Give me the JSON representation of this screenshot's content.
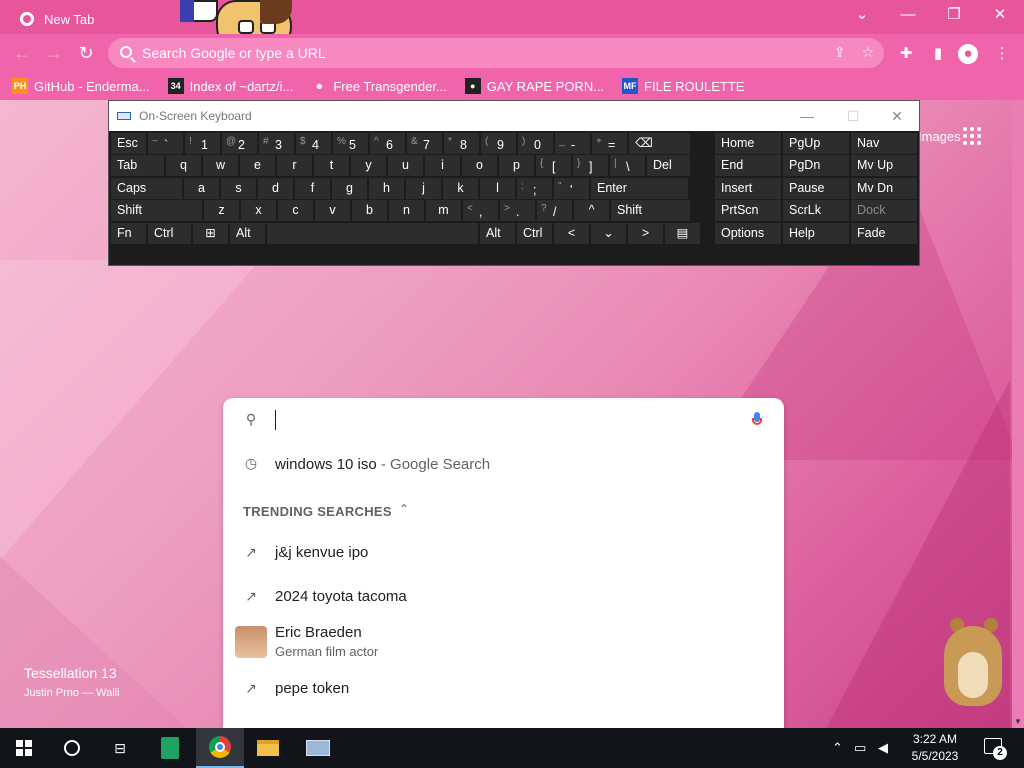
{
  "browser": {
    "tab_title": "New Tab",
    "omnibox_placeholder": "Search Google or type a URL",
    "window_controls": {
      "chevron": "⌄",
      "minimize": "—",
      "restore": "❐",
      "close": "✕"
    },
    "bookmarks": [
      {
        "icon_text": "PH",
        "icon_bg": "#f7931e",
        "label": "GitHub - Enderma..."
      },
      {
        "icon_text": "34",
        "icon_bg": "#222222",
        "label": "Index of ~dartz/i..."
      },
      {
        "icon_text": "☻",
        "icon_bg": "#f064ab",
        "label": "Free Transgender..."
      },
      {
        "icon_text": "●",
        "icon_bg": "#222222",
        "label": "GAY RAPE PORN..."
      },
      {
        "icon_text": "MF",
        "icon_bg": "#2456c8",
        "label": "FILE ROULETTE"
      }
    ],
    "theme_color": "#e7559a"
  },
  "osk": {
    "title": "On-Screen Keyboard",
    "controls": {
      "minimize": "—",
      "maximize": "☐",
      "close": "✕"
    },
    "rows": [
      [
        {
          "label": "Esc",
          "w": 36
        },
        {
          "sub": "~",
          "main": "`",
          "w": 36
        },
        {
          "sub": "!",
          "main": "1",
          "w": 36
        },
        {
          "sub": "@",
          "main": "2",
          "w": 36
        },
        {
          "sub": "#",
          "main": "3",
          "w": 36
        },
        {
          "sub": "$",
          "main": "4",
          "w": 36
        },
        {
          "sub": "%",
          "main": "5",
          "w": 36
        },
        {
          "sub": "^",
          "main": "6",
          "w": 36
        },
        {
          "sub": "&",
          "main": "7",
          "w": 36
        },
        {
          "sub": "*",
          "main": "8",
          "w": 36
        },
        {
          "sub": "(",
          "main": "9",
          "w": 36
        },
        {
          "sub": ")",
          "main": "0",
          "w": 36
        },
        {
          "sub": "_",
          "main": "-",
          "w": 36
        },
        {
          "sub": "+",
          "main": "=",
          "w": 36
        },
        {
          "label": "⌫",
          "w": 62
        }
      ],
      [
        {
          "label": "Tab",
          "w": 54
        },
        {
          "label": "q",
          "w": 36,
          "center": true
        },
        {
          "label": "w",
          "w": 36,
          "center": true
        },
        {
          "label": "e",
          "w": 36,
          "center": true
        },
        {
          "label": "r",
          "w": 36,
          "center": true
        },
        {
          "label": "t",
          "w": 36,
          "center": true
        },
        {
          "label": "y",
          "w": 36,
          "center": true
        },
        {
          "label": "u",
          "w": 36,
          "center": true
        },
        {
          "label": "i",
          "w": 36,
          "center": true
        },
        {
          "label": "o",
          "w": 36,
          "center": true
        },
        {
          "label": "p",
          "w": 36,
          "center": true
        },
        {
          "sub": "{",
          "main": "[",
          "w": 36
        },
        {
          "sub": "}",
          "main": "]",
          "w": 36
        },
        {
          "sub": "|",
          "main": "\\",
          "w": 36
        },
        {
          "label": "Del",
          "w": 44
        }
      ],
      [
        {
          "label": "Caps",
          "w": 72
        },
        {
          "label": "a",
          "w": 36,
          "center": true
        },
        {
          "label": "s",
          "w": 36,
          "center": true
        },
        {
          "label": "d",
          "w": 36,
          "center": true
        },
        {
          "label": "f",
          "w": 36,
          "center": true
        },
        {
          "label": "g",
          "w": 36,
          "center": true
        },
        {
          "label": "h",
          "w": 36,
          "center": true
        },
        {
          "label": "j",
          "w": 36,
          "center": true
        },
        {
          "label": "k",
          "w": 36,
          "center": true
        },
        {
          "label": "l",
          "w": 36,
          "center": true
        },
        {
          "sub": ":",
          "main": ";",
          "w": 36
        },
        {
          "sub": "\"",
          "main": "'",
          "w": 36
        },
        {
          "label": "Enter",
          "w": 98
        }
      ],
      [
        {
          "label": "Shift",
          "w": 92
        },
        {
          "label": "z",
          "w": 36,
          "center": true
        },
        {
          "label": "x",
          "w": 36,
          "center": true
        },
        {
          "label": "c",
          "w": 36,
          "center": true
        },
        {
          "label": "v",
          "w": 36,
          "center": true
        },
        {
          "label": "b",
          "w": 36,
          "center": true
        },
        {
          "label": "n",
          "w": 36,
          "center": true
        },
        {
          "label": "m",
          "w": 36,
          "center": true
        },
        {
          "sub": "<",
          "main": ",",
          "w": 36
        },
        {
          "sub": ">",
          "main": ".",
          "w": 36
        },
        {
          "sub": "?",
          "main": "/",
          "w": 36
        },
        {
          "label": "^",
          "w": 36,
          "center": true
        },
        {
          "label": "Shift",
          "w": 80
        }
      ],
      [
        {
          "label": "Fn",
          "w": 36
        },
        {
          "label": "Ctrl",
          "w": 44
        },
        {
          "label": "⊞",
          "w": 36,
          "center": true
        },
        {
          "label": "Alt",
          "w": 36
        },
        {
          "label": "",
          "w": 212
        },
        {
          "label": "Alt",
          "w": 36
        },
        {
          "label": "Ctrl",
          "w": 36
        },
        {
          "label": "<",
          "w": 36,
          "center": true
        },
        {
          "label": "⌄",
          "w": 36,
          "center": true
        },
        {
          "label": ">",
          "w": 36,
          "center": true
        },
        {
          "label": "▤",
          "w": 36,
          "center": true
        }
      ]
    ],
    "nav_keys": [
      [
        "Home",
        "PgUp",
        "Nav"
      ],
      [
        "End",
        "PgDn",
        "Mv Up"
      ],
      [
        "Insert",
        "Pause",
        "Mv Dn"
      ],
      [
        "PrtScn",
        "ScrLk",
        "Dock"
      ],
      [
        "Options",
        "Help",
        "Fade"
      ]
    ]
  },
  "ntp": {
    "images_link": "Images",
    "search": {
      "history_item": {
        "query": "windows 10 iso",
        "suffix": " - Google Search"
      },
      "trending_header": "TRENDING SEARCHES",
      "trending": [
        {
          "kind": "trend",
          "text": "j&j kenvue ipo"
        },
        {
          "kind": "trend",
          "text": "2024 toyota tacoma"
        },
        {
          "kind": "entity",
          "text": "Eric Braeden",
          "sub": "German film actor"
        },
        {
          "kind": "trend",
          "text": "pepe token"
        }
      ]
    },
    "theme_credit": {
      "title": "Tessellation 13",
      "author": "Justin Prno — Walli"
    }
  },
  "taskbar": {
    "clock_time": "3:22 AM",
    "clock_date": "5/5/2023",
    "notification_count": "2",
    "accent_color": "#7cb8f0"
  }
}
